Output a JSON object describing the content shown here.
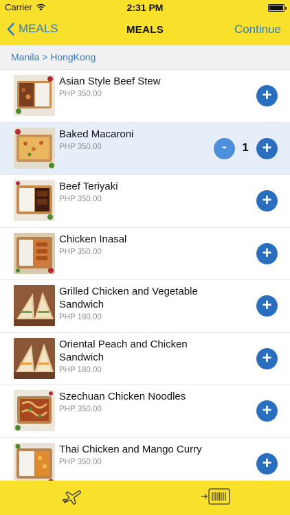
{
  "status_bar": {
    "carrier": "Carrier",
    "time": "2:31 PM"
  },
  "nav": {
    "back_label": "MEALS",
    "title": "MEALS",
    "continue_label": "Continue"
  },
  "breadcrumb": {
    "route": "Manila > HongKong"
  },
  "meals": [
    {
      "name": "Asian Style Beef Stew",
      "price": "PHP 350.00",
      "selected": false
    },
    {
      "name": "Baked Macaroni",
      "price": "PHP 350.00",
      "selected": true,
      "quantity": "1",
      "minus_label": "-"
    },
    {
      "name": "Beef Teriyaki",
      "price": "PHP 350.00",
      "selected": false
    },
    {
      "name": "Chicken Inasal",
      "price": "PHP 350.00",
      "selected": false
    },
    {
      "name": "Grilled Chicken and Vegetable Sandwich",
      "price": "PHP 180.00",
      "selected": false
    },
    {
      "name": "Oriental Peach and Chicken Sandwich",
      "price": "PHP 180.00",
      "selected": false
    },
    {
      "name": "Szechuan Chicken Noodles",
      "price": "PHP 350.00",
      "selected": false
    },
    {
      "name": "Thai Chicken and Mango Curry",
      "price": "PHP 350.00",
      "selected": false
    }
  ],
  "plus_label": "+",
  "tabs": [
    {
      "icon": "airplane-icon"
    },
    {
      "icon": "boarding-pass-icon"
    }
  ],
  "colors": {
    "accent_yellow": "#f9e02b",
    "link_blue": "#2e7bc4",
    "button_blue": "#2a6ebf",
    "selected_row": "#e6eefa"
  }
}
